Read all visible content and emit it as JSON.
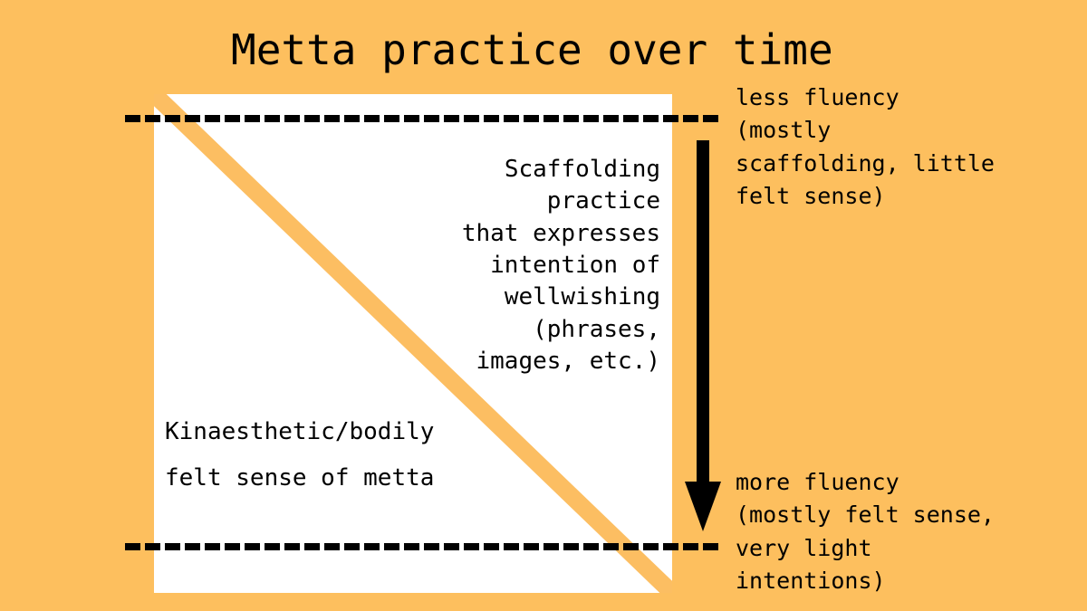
{
  "title": "Metta practice over time",
  "colors": {
    "background": "#fdbf5e",
    "panel": "#ffffff",
    "diagonal": "#fcbe62",
    "ink": "#000000"
  },
  "panel": {
    "scaffolding_label": "Scaffolding\npractice\nthat expresses\nintention of\nwellwishing\n(phrases,\nimages, etc.)",
    "kinaesthetic_label": "Kinaesthetic/bodily\nfelt sense of metta"
  },
  "annotations": {
    "top_note": "less fluency\n(mostly\nscaffolding, little\nfelt sense)",
    "bottom_note": "more fluency\n(mostly felt sense,\nvery light\nintentions)"
  },
  "icons": {
    "arrow": "down-arrow-icon",
    "rule": "dashed-line-icon",
    "band": "diagonal-band-icon"
  }
}
